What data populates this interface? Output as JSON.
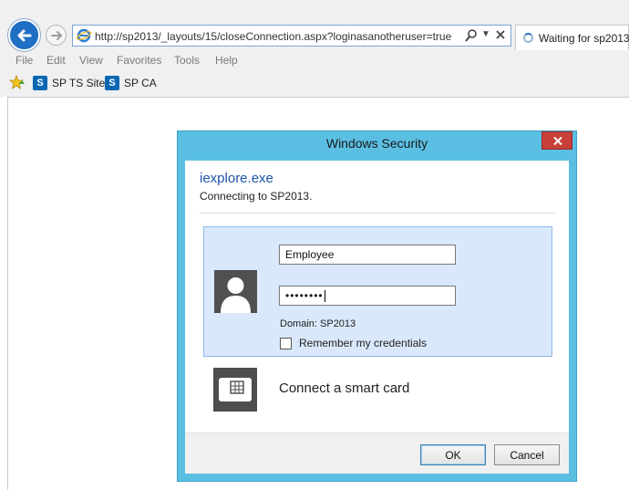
{
  "browser": {
    "address_url": "http://sp2013/_layouts/15/closeConnection.aspx?loginasanotheruser=true",
    "tab_title": "Waiting for sp2013",
    "menu": [
      "File",
      "Edit",
      "View",
      "Favorites",
      "Tools",
      "Help"
    ],
    "favorites": [
      {
        "label": "SP TS Site",
        "icon": "sharepoint-icon"
      },
      {
        "label": "SP CA",
        "icon": "sharepoint-icon"
      }
    ]
  },
  "dialog": {
    "title": "Windows Security",
    "app_name": "iexplore.exe",
    "connecting_text": "Connecting to SP2013.",
    "username_value": "Employee",
    "password_mask": "••••••••",
    "domain_text": "Domain: SP2013",
    "remember_label": "Remember my credentials",
    "remember_checked": false,
    "smart_card_label": "Connect a smart card",
    "ok_label": "OK",
    "cancel_label": "Cancel"
  },
  "colors": {
    "dialog_frame": "#5bbfe3",
    "close_button": "#c7403a",
    "credential_panel": "#d9e8fb",
    "link_blue": "#1d55a8"
  }
}
